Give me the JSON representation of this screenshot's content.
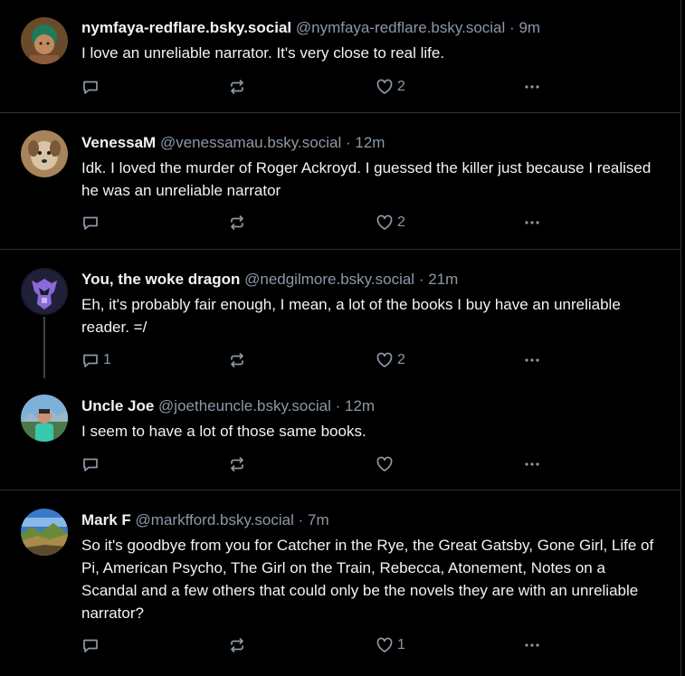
{
  "posts": [
    {
      "name": "nymfaya-redflare.bsky.social",
      "handle": "@nymfaya-redflare.bsky.social",
      "sep": "·",
      "time": "9m",
      "text": "I love an unreliable narrator. It's very close to real life.",
      "reply_count": "",
      "repost_count": "",
      "like_count": "2"
    },
    {
      "name": "VenessaM",
      "handle": "@venessamau.bsky.social",
      "sep": "·",
      "time": "12m",
      "text": "Idk. I loved the murder of Roger Ackroyd. I guessed the killer just because I realised he was an unreliable narrator",
      "reply_count": "",
      "repost_count": "",
      "like_count": "2"
    },
    {
      "name": "You, the woke dragon",
      "handle": "@nedgilmore.bsky.social",
      "sep": "·",
      "time": "21m",
      "text": "Eh, it's probably fair enough, I mean, a lot of the books I buy have an unreliable reader. =/",
      "reply_count": "1",
      "repost_count": "",
      "like_count": "2"
    },
    {
      "name": "Uncle Joe",
      "handle": "@joetheuncle.bsky.social",
      "sep": "·",
      "time": "12m",
      "text": "I seem to have a lot of those same books.",
      "reply_count": "",
      "repost_count": "",
      "like_count": ""
    },
    {
      "name": "Mark F",
      "handle": "@markfford.bsky.social",
      "sep": "·",
      "time": "7m",
      "text": "So it's goodbye from you for Catcher in the Rye, the Great Gatsby, Gone Girl, Life of Pi, American Psycho, The Girl on the Train, Rebecca, Atonement, Notes on a Scandal and a few others that could only be the novels they are with an unreliable narrator?",
      "reply_count": "",
      "repost_count": "",
      "like_count": "1"
    }
  ],
  "icons": {
    "reply": "reply-icon",
    "repost": "repost-icon",
    "like": "like-icon",
    "more": "more-options-icon"
  },
  "colors": {
    "background": "#000000",
    "text": "#f1f3f5",
    "muted": "#8c98a6",
    "border": "#2e3438"
  }
}
